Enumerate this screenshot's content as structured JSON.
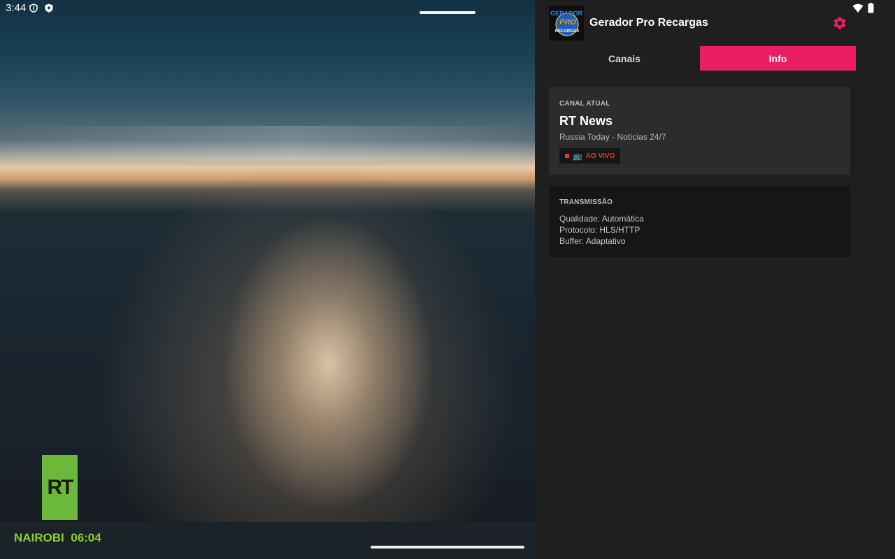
{
  "status_bar": {
    "time": "3:44",
    "vpn_icon": "vpn-key-icon",
    "shield_icon": "shield-icon",
    "wifi_icon": "wifi-icon",
    "battery_icon": "battery-icon"
  },
  "video": {
    "logo_text": "RT",
    "logo_color": "#6bb83a",
    "ticker_city": "NAIROBI",
    "ticker_time": "06:04",
    "ticker_color": "#8ccf2c"
  },
  "app": {
    "title": "Gerador Pro Recargas",
    "logo_lines": [
      "GERADOR",
      "PRO",
      "RECARGAS"
    ],
    "settings_icon": "gear-icon",
    "accent": "#e91e63"
  },
  "tabs": [
    {
      "label": "Canais",
      "active": false
    },
    {
      "label": "Info",
      "active": true
    }
  ],
  "current_channel": {
    "section_label": "CANAL ATUAL",
    "name": "RT News",
    "description": "Russia Today - Notícias 24/7",
    "live_label": "AO VIVO",
    "live_icon": "tv-icon"
  },
  "transmission": {
    "section_label": "TRANSMISSÃO",
    "quality": "Qualidade: Automática",
    "protocol": "Protocolo: HLS/HTTP",
    "buffer": "Buffer: Adaptativo"
  }
}
